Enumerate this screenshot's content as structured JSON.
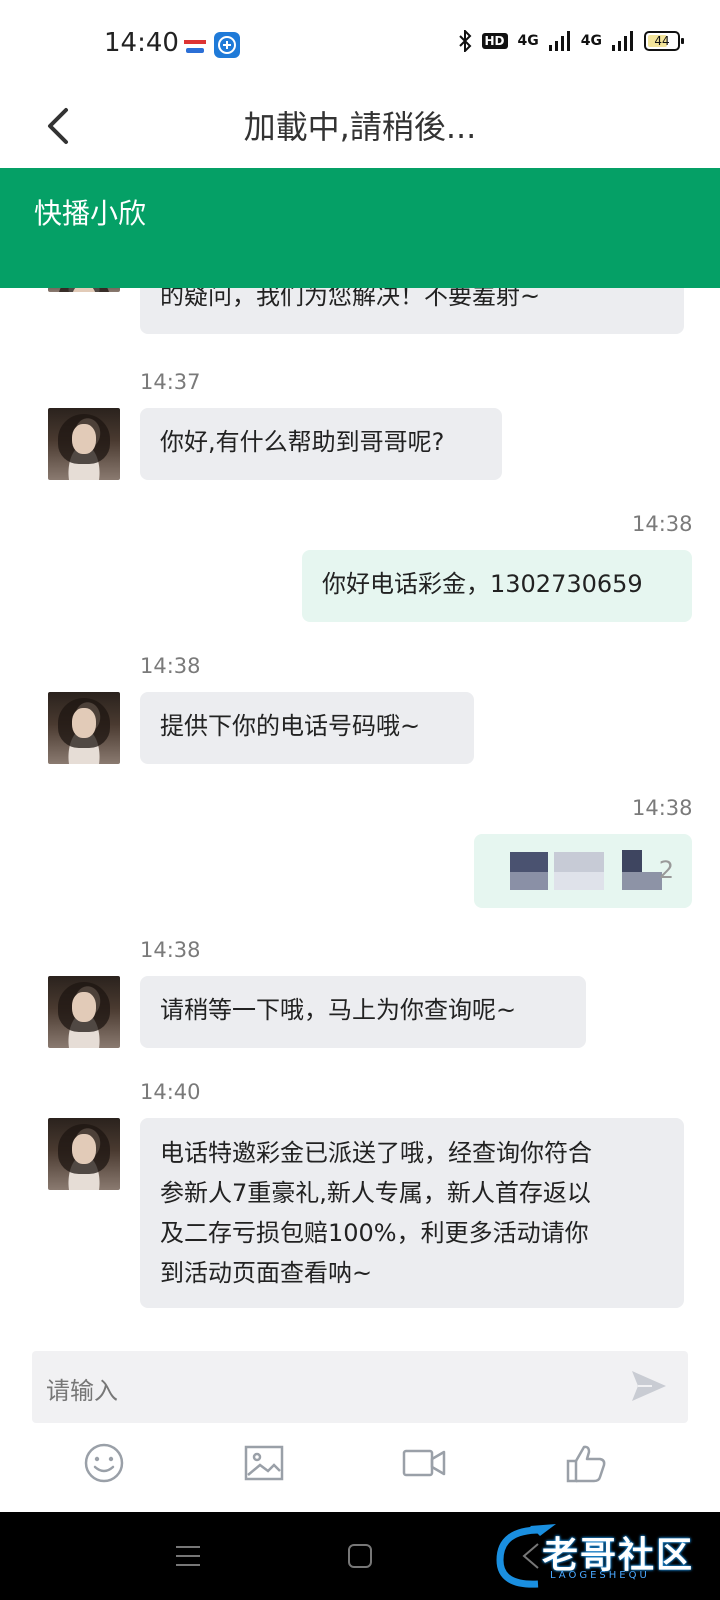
{
  "status_bar": {
    "time": "14:40",
    "battery": "44",
    "network_1": "4G",
    "network_2": "4G",
    "hd_badge": "HD"
  },
  "nav": {
    "title": "加載中,請稍後..."
  },
  "header": {
    "agent_name": "快播小欣",
    "color": "#05a066"
  },
  "messages": [
    {
      "side": "in",
      "time": "",
      "text": "的疑问，我们为您解决！不要羞射~"
    },
    {
      "side": "in",
      "time": "14:37",
      "text": "你好,有什么帮助到哥哥呢?"
    },
    {
      "side": "out",
      "time": "14:38",
      "text": "你好电话彩金，1302730659"
    },
    {
      "side": "in",
      "time": "14:38",
      "text": "提供下你的电话号码哦~"
    },
    {
      "side": "out",
      "time": "14:38",
      "text": "2"
    },
    {
      "side": "in",
      "time": "14:38",
      "text": "请稍等一下哦，马上为你查询呢~"
    },
    {
      "side": "in",
      "time": "14:40",
      "lines": [
        "电话特邀彩金已派送了哦，经查询你符合",
        "参新人7重豪礼,新人专属，新人首存返以",
        "及二存亏损包赔100%，利更多活动请你",
        "到活动页面查看呐~"
      ]
    }
  ],
  "input": {
    "placeholder": "请输入"
  },
  "toolbar": {
    "items": [
      "emoji-icon",
      "image-icon",
      "video-icon",
      "thumbs-up-icon"
    ]
  },
  "watermark": {
    "text": "老哥社区",
    "sub": "LAOGESHEQU"
  }
}
